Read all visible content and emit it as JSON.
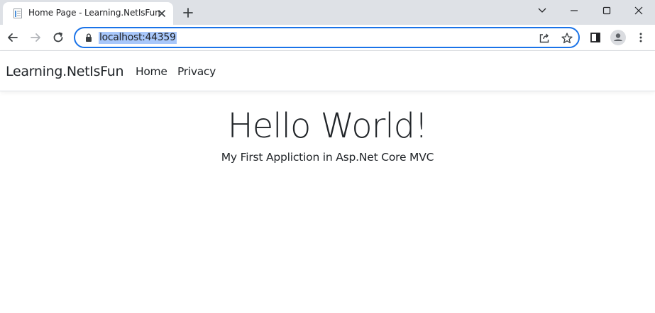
{
  "browser": {
    "tab": {
      "title": "Home Page - Learning.NetIsFun",
      "favicon": "page-icon"
    },
    "new_tab_icon": "plus-icon",
    "window_controls": [
      "chevron-down-icon",
      "minimize-icon",
      "maximize-icon",
      "close-icon"
    ],
    "address_bar": {
      "url": "localhost:44359",
      "selected": true
    },
    "accent": "#1a73e8",
    "selection_color": "#a8c7fa"
  },
  "site": {
    "navbar": {
      "brand": "Learning.NetIsFun",
      "links": [
        {
          "label": "Home"
        },
        {
          "label": "Privacy"
        }
      ]
    },
    "main": {
      "heading": "Hello World!",
      "subheading": "My First Appliction in Asp.Net Core MVC"
    }
  }
}
